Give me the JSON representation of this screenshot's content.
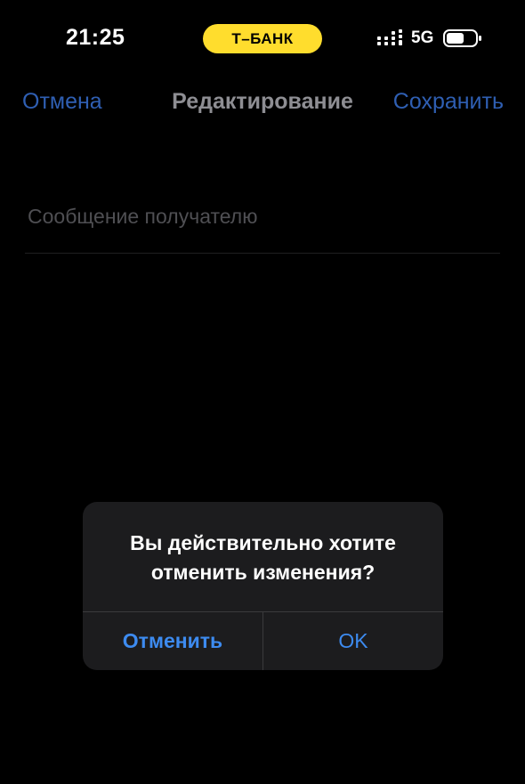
{
  "status_bar": {
    "time": "21:25",
    "bank_badge": "Т–БАНК",
    "network": "5G",
    "signal_icon": "cellular-signal-icon",
    "battery_icon": "battery-icon"
  },
  "nav": {
    "cancel_label": "Отмена",
    "title": "Редактирование",
    "save_label": "Сохранить"
  },
  "form": {
    "message_placeholder": "Сообщение получателю"
  },
  "alert": {
    "message": "Вы действительно хотите отменить изменения?",
    "confirm_label": "Отменить",
    "ok_label": "OK"
  },
  "colors": {
    "background": "#000000",
    "accent_blue": "#3d8bf0",
    "bank_yellow": "#ffdd2d",
    "alert_background": "#1c1c1e"
  }
}
